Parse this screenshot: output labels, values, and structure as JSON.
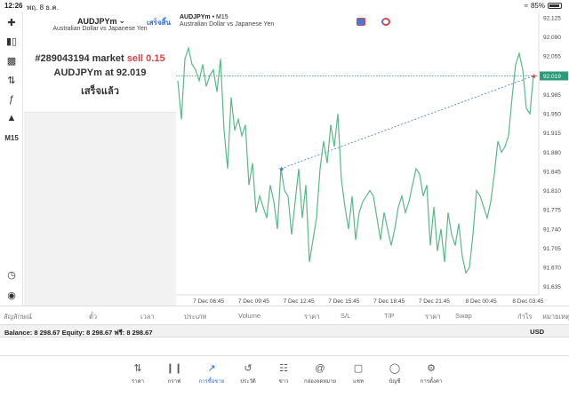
{
  "status": {
    "time": "12:26",
    "date": "พฤ. 8 ธ.ค.",
    "battery": "85%"
  },
  "toolbar": {
    "timeframe": "M15"
  },
  "info": {
    "symbol": "AUDJPYm",
    "description": "Australian Dollar vs Japanese Yen",
    "done_label": "เสร็จสิ้น",
    "order_prefix": "#289043194 market ",
    "order_side": "sell 0.15",
    "order_price_line": "AUDJPYm at 92.019",
    "status": "เสร็จแล้ว"
  },
  "chart_header": {
    "symbol": "AUDJPYm",
    "timeframe": "M15",
    "description": "Australian Dollar vs Japanese Yen"
  },
  "colors": {
    "line": "#5bb88a",
    "price_line": "#2e9a7a",
    "trade_line": "#3a7ac8",
    "accent": "#2a6fd6",
    "sell": "#d64545"
  },
  "chart_data": {
    "type": "line",
    "ylim": [
      91.62,
      92.125
    ],
    "yticks": [
      "92.125",
      "92.090",
      "92.055",
      "92.019",
      "91.985",
      "91.950",
      "91.915",
      "91.880",
      "91.845",
      "91.810",
      "91.775",
      "91.740",
      "91.705",
      "91.670",
      "91.635"
    ],
    "current_price": 92.019,
    "xticks": [
      "7 Dec 06:45",
      "7 Dec 09:45",
      "7 Dec 12:45",
      "7 Dec 15:45",
      "7 Dec 18:45",
      "7 Dec 21:45",
      "8 Dec 00:45",
      "8 Dec 03:45"
    ],
    "values": [
      92.01,
      91.94,
      92.05,
      92.07,
      92.04,
      92.03,
      92.01,
      92.04,
      92.0,
      92.02,
      92.03,
      91.99,
      92.05,
      91.92,
      91.85,
      91.98,
      91.92,
      91.94,
      91.91,
      91.93,
      91.82,
      91.86,
      91.77,
      91.8,
      91.78,
      91.76,
      91.82,
      91.79,
      91.74,
      91.85,
      91.81,
      91.8,
      91.73,
      91.79,
      91.85,
      91.76,
      91.82,
      91.68,
      91.72,
      91.76,
      91.85,
      91.9,
      91.86,
      91.93,
      91.89,
      91.95,
      91.83,
      91.78,
      91.74,
      91.8,
      91.72,
      91.77,
      91.79,
      91.8,
      91.81,
      91.8,
      91.76,
      91.72,
      91.77,
      91.74,
      91.71,
      91.74,
      91.78,
      91.8,
      91.77,
      91.79,
      91.82,
      91.85,
      91.84,
      91.8,
      91.82,
      91.71,
      91.78,
      91.7,
      91.74,
      91.68,
      91.77,
      91.73,
      91.71,
      91.75,
      91.69,
      91.66,
      91.67,
      91.73,
      91.81,
      91.8,
      91.78,
      91.76,
      91.79,
      91.84,
      91.9,
      91.88,
      91.89,
      91.91,
      91.98,
      92.04,
      92.06,
      92.03,
      91.96,
      91.95,
      92.02
    ],
    "trade_open": {
      "index": 29,
      "price": 91.85
    },
    "trade_close": {
      "index": 100,
      "price": 92.019
    }
  },
  "columns": [
    "สัญลักษณ์",
    "ตั๋ว",
    "เวลา",
    "ประเภท",
    "Volume",
    "ราคา",
    "S/L",
    "T/P",
    "ราคา",
    "Swap",
    "กำไร",
    "หมายเหตุ"
  ],
  "balance": {
    "text": "Balance: 8 298.67 Equity: 8 298.67 ฟรี: 8 298.67",
    "currency": "USD"
  },
  "tabs": [
    {
      "label": "ราคา",
      "icon": "quotes-icon"
    },
    {
      "label": "กราฟ",
      "icon": "chart-icon"
    },
    {
      "label": "การซื้อขาย",
      "icon": "trade-icon"
    },
    {
      "label": "ประวัติ",
      "icon": "history-icon"
    },
    {
      "label": "ข่าว",
      "icon": "news-icon"
    },
    {
      "label": "กล่องจดหมาย",
      "icon": "mailbox-icon"
    },
    {
      "label": "แชท",
      "icon": "chat-icon"
    },
    {
      "label": "บัญชี",
      "icon": "account-icon"
    },
    {
      "label": "การตั้งค่า",
      "icon": "settings-icon"
    }
  ]
}
